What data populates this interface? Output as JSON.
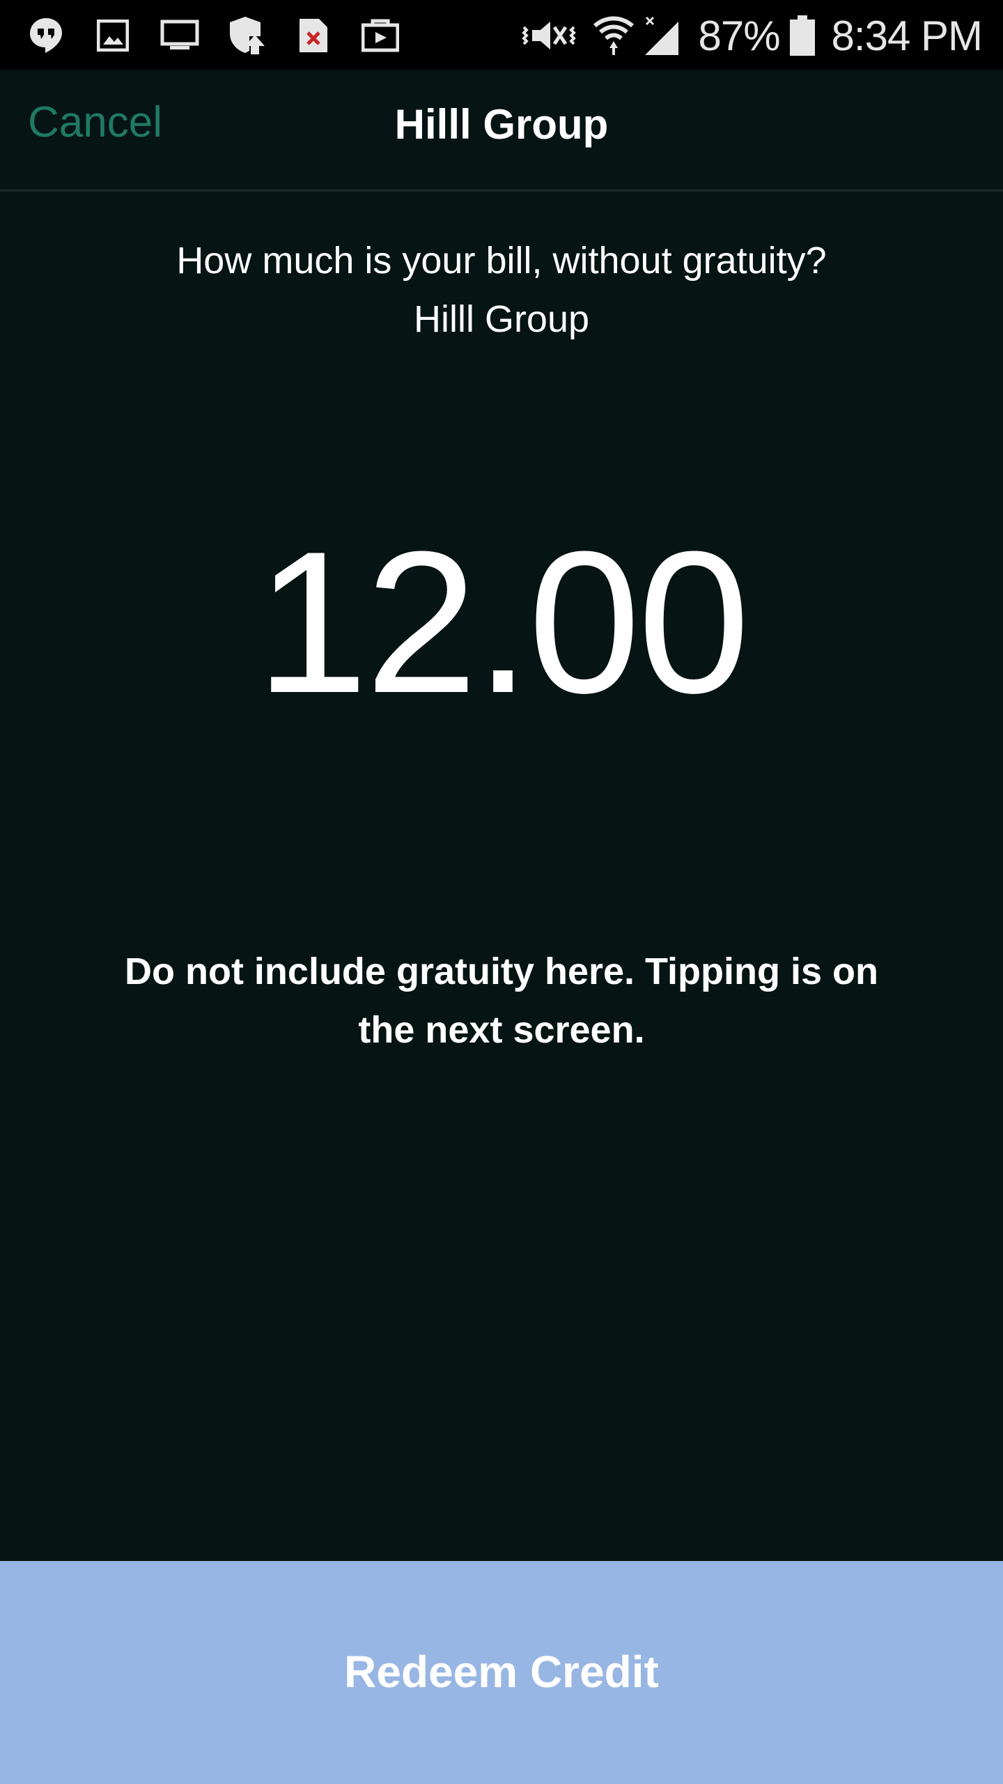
{
  "status_bar": {
    "left_icons": [
      "hangouts-icon",
      "gallery-icon",
      "cast-screen-icon",
      "shield-update-icon",
      "file-error-icon",
      "briefcase-icon"
    ],
    "right_icons": [
      "vibrate-mute-icon",
      "wifi-icon",
      "no-signal-icon",
      "battery-icon"
    ],
    "battery_percent": "87%",
    "time": "8:34 PM"
  },
  "nav": {
    "cancel_label": "Cancel",
    "title": "Hilll Group"
  },
  "content": {
    "question_line1": "How much is your bill, without gratuity?",
    "question_line2": "Hilll Group",
    "amount": "12.00",
    "notice": "Do not include gratuity here. Tipping is on the next screen."
  },
  "footer": {
    "redeem_label": "Redeem Credit"
  },
  "colors": {
    "background": "#061413",
    "accent": "#1f7a63",
    "button": "#98b6e3"
  }
}
